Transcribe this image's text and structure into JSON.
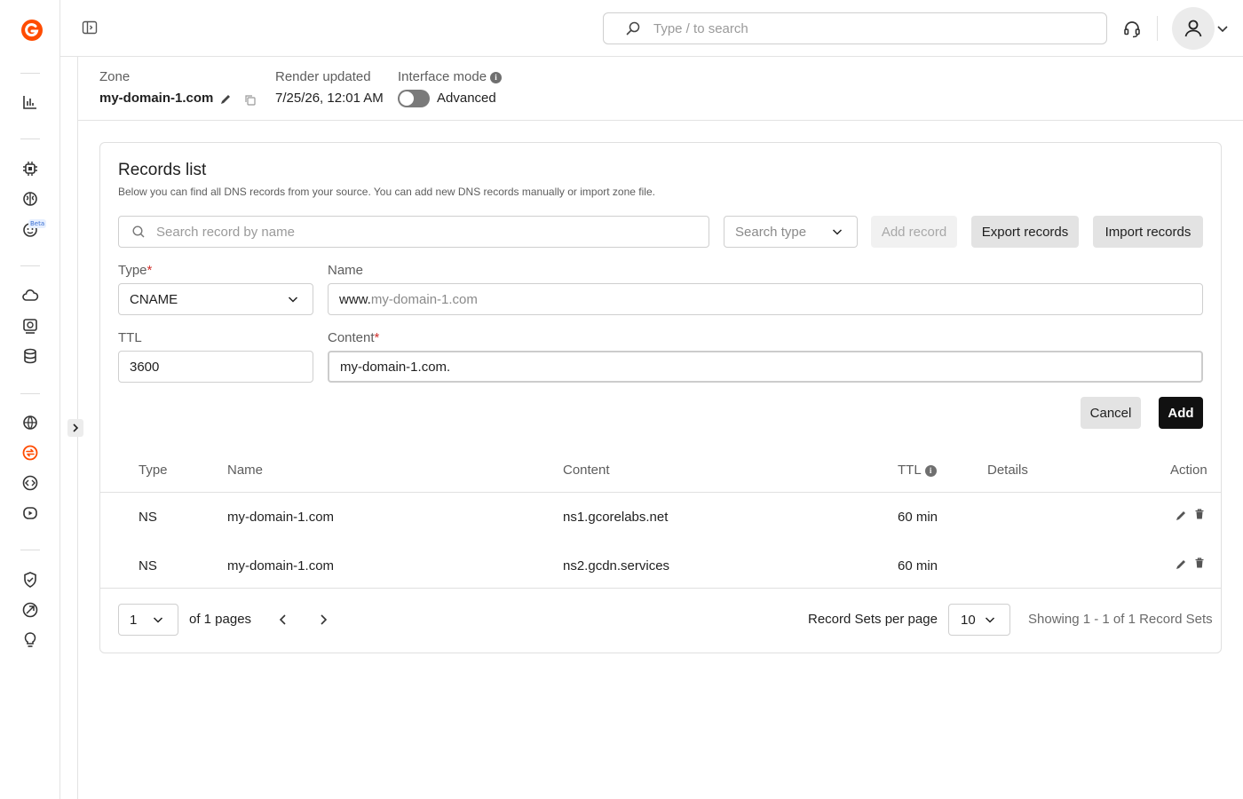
{
  "topbar": {
    "search_placeholder": "Type / to search"
  },
  "nav": {
    "beta_badge": "Beta",
    "accent": "#ff4c00"
  },
  "zone": {
    "zone_label": "Zone",
    "zone_name": "my-domain-1.com",
    "render_label": "Render updated",
    "render_value": "7/25/26, 12:01 AM",
    "mode_label": "Interface mode",
    "mode_value": "Advanced"
  },
  "records": {
    "title": "Records list",
    "subtitle": "Below you can find all DNS records from your source. You can add new DNS records manually or import zone file.",
    "search_placeholder": "Search record by name",
    "search_type_placeholder": "Search type",
    "add_record_label": "Add record",
    "export_label": "Export records",
    "import_label": "Import records"
  },
  "form": {
    "type_label": "Type",
    "type_value": "CNAME",
    "name_label": "Name",
    "name_prefix": "www.",
    "name_suffix": "my-domain-1.com",
    "ttl_label": "TTL",
    "ttl_value": "3600",
    "content_label": "Content",
    "content_value": "my-domain-1.com.",
    "required_mark": "*",
    "cancel_label": "Cancel",
    "add_label": "Add"
  },
  "table": {
    "headers": {
      "type": "Type",
      "name": "Name",
      "content": "Content",
      "ttl": "TTL",
      "details": "Details",
      "action": "Action"
    },
    "rows": [
      {
        "type": "NS",
        "name": "my-domain-1.com",
        "content": "ns1.gcorelabs.net",
        "ttl": "60 min",
        "details": ""
      },
      {
        "type": "NS",
        "name": "my-domain-1.com",
        "content": "ns2.gcdn.services",
        "ttl": "60 min",
        "details": ""
      }
    ]
  },
  "pager": {
    "page_value": "1",
    "of_pages": "of 1 pages",
    "per_page_label": "Record Sets per page",
    "per_page_value": "10",
    "showing": "Showing 1 - 1 of 1 Record Sets"
  }
}
